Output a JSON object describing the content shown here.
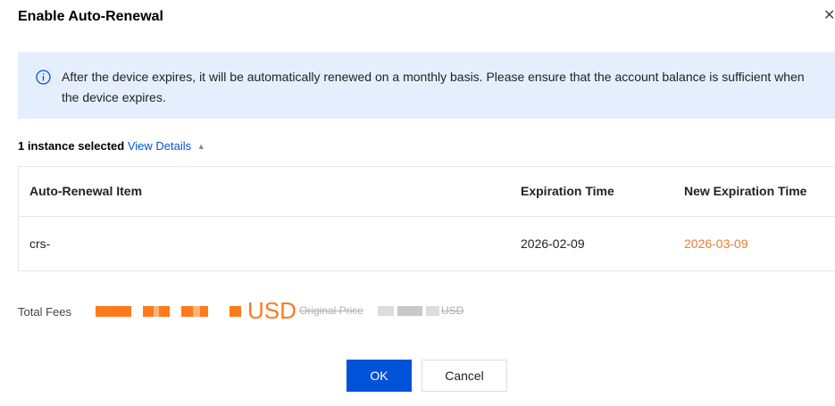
{
  "dialog": {
    "title": "Enable Auto-Renewal",
    "close_icon": "close-icon"
  },
  "notice": {
    "icon": "info-icon",
    "accent": "#0052d9",
    "background": "#e5eefc",
    "text": "After the device expires, it will be automatically renewed on a monthly basis. Please ensure that the account balance is sufficient when the device expires."
  },
  "selection": {
    "count_text": "1 instance selected",
    "view_details": "View Details",
    "caret_icon": "caret-up-icon"
  },
  "table": {
    "columns": [
      "Auto-Renewal Item",
      "Expiration Time",
      "New Expiration Time"
    ],
    "rows": [
      {
        "item": "crs-",
        "expiration": "2026-02-09",
        "new_expiration": "2026-03-09"
      }
    ]
  },
  "fees": {
    "label": "Total Fees",
    "currency": "USD",
    "original_price_label": "Original Price",
    "original_currency": "USD",
    "price_color": "#ff7a1a"
  },
  "buttons": {
    "ok": "OK",
    "cancel": "Cancel",
    "primary_color": "#0052d9"
  }
}
